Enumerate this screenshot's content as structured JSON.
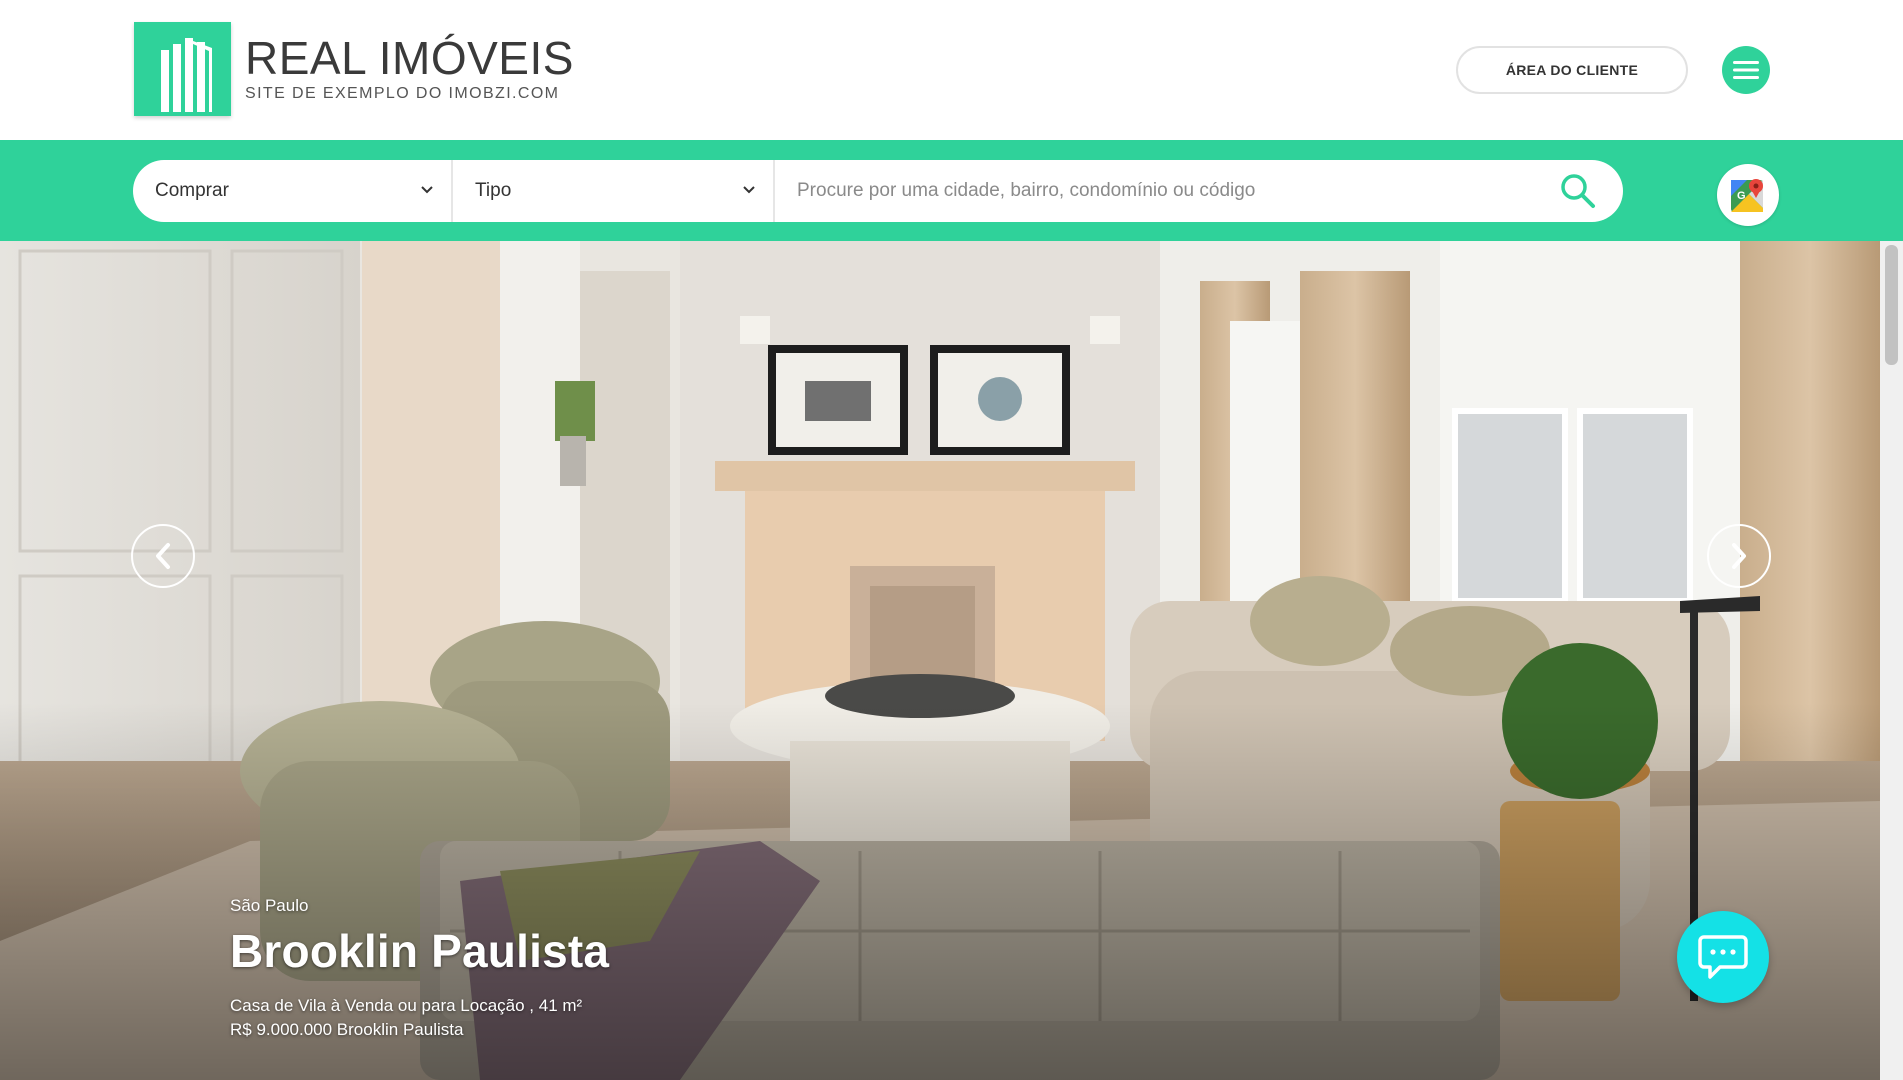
{
  "brand": {
    "title": "REAL IMÓVEIS",
    "subtitle": "SITE DE EXEMPLO DO IMOBZI.COM",
    "accent_color": "#2fd29a"
  },
  "header": {
    "client_area_label": "ÁREA DO CLIENTE",
    "menu_icon": "hamburger-icon"
  },
  "search": {
    "transaction_value": "Comprar",
    "type_value": "Tipo",
    "placeholder": "Procure por uma cidade, bairro, condomínio ou código",
    "search_icon": "search-icon",
    "map_icon": "google-maps-icon"
  },
  "hero": {
    "city": "São Paulo",
    "title": "Brooklin Paulista",
    "description": "Casa de Vila à Venda ou para Locação , 41 m²",
    "price_line": "R$ 9.000.000 Brooklin Paulista",
    "prev_icon": "chevron-left-icon",
    "next_icon": "chevron-right-icon"
  },
  "chat": {
    "icon": "chat-bubble-icon",
    "color": "#14e1e6"
  }
}
